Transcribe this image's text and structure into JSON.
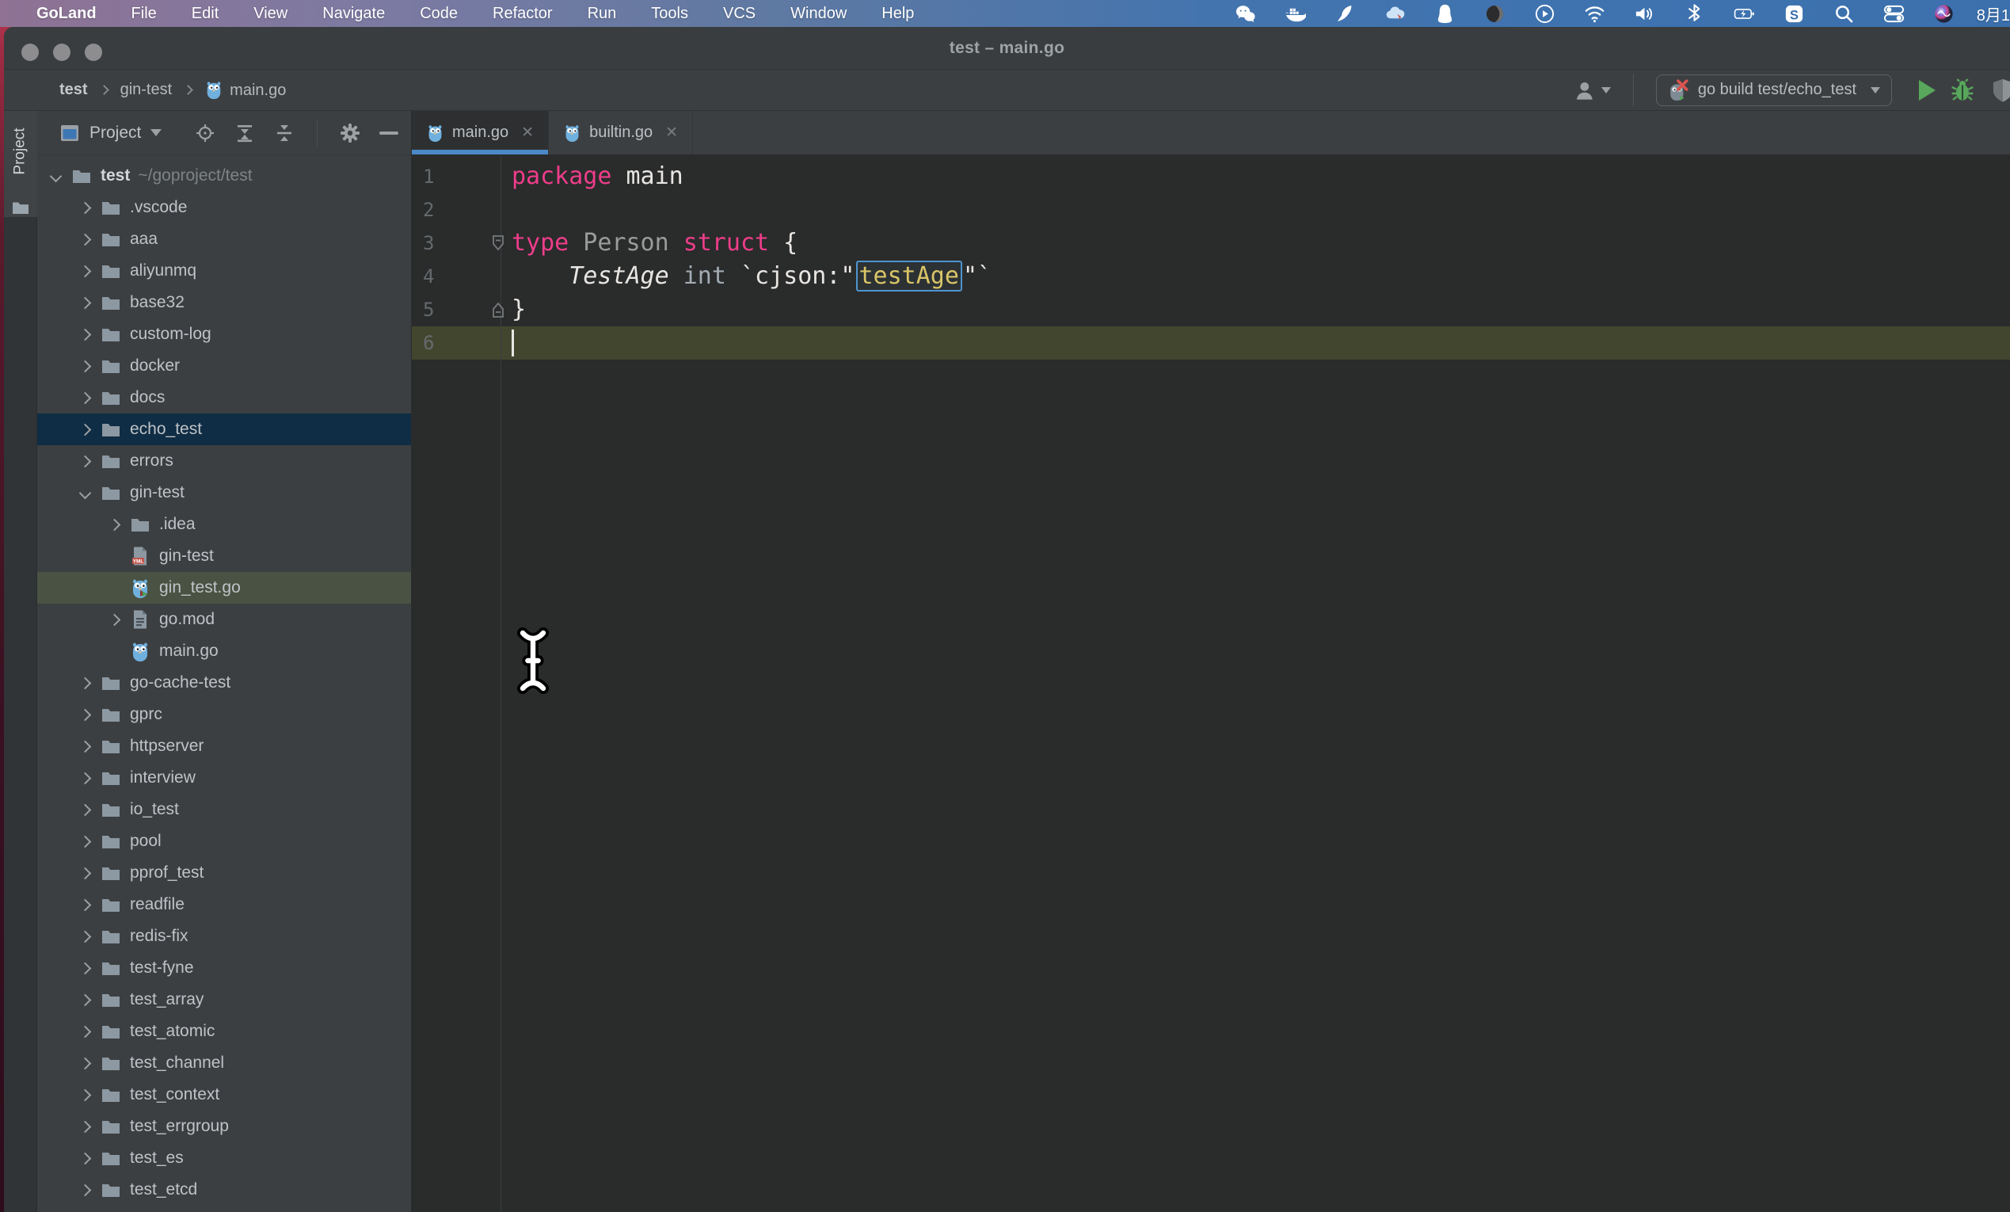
{
  "menubar": {
    "app_name": "GoLand",
    "menus": [
      "File",
      "Edit",
      "View",
      "Navigate",
      "Code",
      "Refactor",
      "Run",
      "Tools",
      "VCS",
      "Window",
      "Help"
    ],
    "status_icons": [
      "wechat-icon",
      "docker-icon",
      "bird-icon",
      "cloud-icon",
      "penguin-icon",
      "recorder-icon",
      "play-circle-icon",
      "wifi-icon",
      "volume-icon",
      "bluetooth-icon",
      "battery-charging-icon",
      "sogou-icon",
      "spotlight-search-icon",
      "control-center-icon",
      "siri-icon"
    ],
    "date_text": "8月1"
  },
  "window": {
    "title": "test – main.go"
  },
  "breadcrumbs": {
    "items": [
      {
        "label": "test",
        "bold": true
      },
      {
        "label": "gin-test"
      },
      {
        "label": "main.go",
        "icon": "gopher"
      }
    ]
  },
  "run_toolbar": {
    "config_label": "go build test/echo_test",
    "config_icon": "gopher-error-icon",
    "actions": [
      "run-button",
      "debug-button",
      "coverage-button"
    ]
  },
  "project_panel": {
    "title": "Project",
    "toolbar_icons": [
      "locate-icon",
      "expand-all-icon",
      "collapse-all-icon",
      "gear-icon",
      "hide-icon"
    ],
    "tree": [
      {
        "label": "test",
        "path": "~/goproject/test",
        "level": 0,
        "icon": "folder",
        "chevron": "down",
        "bold": true
      },
      {
        "label": ".vscode",
        "level": 1,
        "icon": "folder",
        "chevron": "right"
      },
      {
        "label": "aaa",
        "level": 1,
        "icon": "folder",
        "chevron": "right"
      },
      {
        "label": "aliyunmq",
        "level": 1,
        "icon": "folder",
        "chevron": "right"
      },
      {
        "label": "base32",
        "level": 1,
        "icon": "folder",
        "chevron": "right"
      },
      {
        "label": "custom-log",
        "level": 1,
        "icon": "folder",
        "chevron": "right"
      },
      {
        "label": "docker",
        "level": 1,
        "icon": "folder",
        "chevron": "right"
      },
      {
        "label": "docs",
        "level": 1,
        "icon": "folder",
        "chevron": "right"
      },
      {
        "label": "echo_test",
        "level": 1,
        "icon": "folder",
        "chevron": "right",
        "sel": "blue"
      },
      {
        "label": "errors",
        "level": 1,
        "icon": "folder",
        "chevron": "right"
      },
      {
        "label": "gin-test",
        "level": 1,
        "icon": "folder",
        "chevron": "down"
      },
      {
        "label": ".idea",
        "level": 2,
        "icon": "folder",
        "chevron": "right"
      },
      {
        "label": "gin-test",
        "level": 2,
        "icon": "yml",
        "chevron": "none"
      },
      {
        "label": "gin_test.go",
        "level": 2,
        "icon": "gopher-run",
        "chevron": "none",
        "sel": "green"
      },
      {
        "label": "go.mod",
        "level": 2,
        "icon": "gomod",
        "chevron": "right"
      },
      {
        "label": "main.go",
        "level": 2,
        "icon": "gopher",
        "chevron": "none"
      },
      {
        "label": "go-cache-test",
        "level": 1,
        "icon": "folder",
        "chevron": "right"
      },
      {
        "label": "gprc",
        "level": 1,
        "icon": "folder",
        "chevron": "right"
      },
      {
        "label": "httpserver",
        "level": 1,
        "icon": "folder",
        "chevron": "right"
      },
      {
        "label": "interview",
        "level": 1,
        "icon": "folder",
        "chevron": "right"
      },
      {
        "label": "io_test",
        "level": 1,
        "icon": "folder",
        "chevron": "right"
      },
      {
        "label": "pool",
        "level": 1,
        "icon": "folder",
        "chevron": "right"
      },
      {
        "label": "pprof_test",
        "level": 1,
        "icon": "folder",
        "chevron": "right"
      },
      {
        "label": "readfile",
        "level": 1,
        "icon": "folder",
        "chevron": "right"
      },
      {
        "label": "redis-fix",
        "level": 1,
        "icon": "folder",
        "chevron": "right"
      },
      {
        "label": "test-fyne",
        "level": 1,
        "icon": "folder",
        "chevron": "right"
      },
      {
        "label": "test_array",
        "level": 1,
        "icon": "folder",
        "chevron": "right"
      },
      {
        "label": "test_atomic",
        "level": 1,
        "icon": "folder",
        "chevron": "right"
      },
      {
        "label": "test_channel",
        "level": 1,
        "icon": "folder",
        "chevron": "right"
      },
      {
        "label": "test_context",
        "level": 1,
        "icon": "folder",
        "chevron": "right"
      },
      {
        "label": "test_errgroup",
        "level": 1,
        "icon": "folder",
        "chevron": "right"
      },
      {
        "label": "test_es",
        "level": 1,
        "icon": "folder",
        "chevron": "right"
      },
      {
        "label": "test_etcd",
        "level": 1,
        "icon": "folder",
        "chevron": "right"
      }
    ]
  },
  "editor": {
    "tabs": [
      {
        "label": "main.go",
        "icon": "gopher",
        "active": true
      },
      {
        "label": "builtin.go",
        "icon": "gopher",
        "active": false
      }
    ],
    "caret_line": 6,
    "fold_markers": [
      {
        "line": 3,
        "kind": "start"
      },
      {
        "line": 5,
        "kind": "end"
      }
    ],
    "lines": [
      {
        "num": "1",
        "tokens": [
          {
            "c": "k",
            "t": "package"
          },
          {
            "c": "w",
            "t": " main"
          }
        ]
      },
      {
        "num": "2",
        "tokens": []
      },
      {
        "num": "3",
        "tokens": [
          {
            "c": "k",
            "t": "type"
          },
          {
            "c": "g",
            "t": " Person "
          },
          {
            "c": "k",
            "t": "struct"
          },
          {
            "c": "w",
            "t": " {"
          }
        ]
      },
      {
        "num": "4",
        "tokens": [
          {
            "c": "wi",
            "t": "    TestAge"
          },
          {
            "c": "t",
            "t": " int "
          },
          {
            "c": "w",
            "t": "`cjson:\""
          },
          {
            "c": "y",
            "t": "testAge",
            "boxed": true
          },
          {
            "c": "w",
            "t": "\"`"
          }
        ]
      },
      {
        "num": "5",
        "tokens": [
          {
            "c": "w",
            "t": "}"
          }
        ]
      },
      {
        "num": "6",
        "tokens": []
      }
    ]
  },
  "colors": {
    "accent_blue": "#4a88c7",
    "keyword_pink": "#ee3d8a",
    "string_yellow": "#d9c567",
    "selection_blue": "#0f2d44",
    "selection_green": "#4a5243",
    "caret_line_olive": "#43462f",
    "run_green": "#58a75c",
    "editor_bg": "#2a2b2b",
    "panel_bg": "#3c3f41"
  }
}
